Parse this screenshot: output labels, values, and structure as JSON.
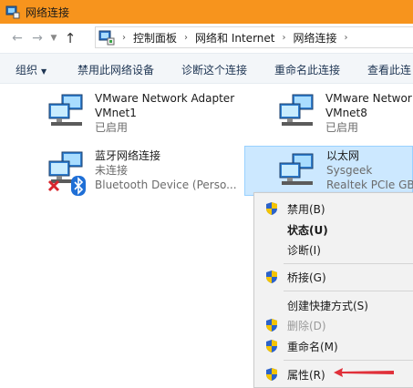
{
  "window": {
    "title": "网络连接"
  },
  "address": {
    "crumbs": [
      "控制面板",
      "网络和 Internet",
      "网络连接"
    ]
  },
  "toolbar": {
    "organize": "组织",
    "disable": "禁用此网络设备",
    "diagnose": "诊断这个连接",
    "rename": "重命名此连接",
    "view_status": "查看此连"
  },
  "items": [
    {
      "name": "VMware Network Adapter",
      "sub": "VMnet1",
      "status": "已启用"
    },
    {
      "name": "VMware Networ",
      "sub": "VMnet8",
      "status": "已启用"
    },
    {
      "name": "蓝牙网络连接",
      "sub": "未连接",
      "status": "Bluetooth Device (Perso..."
    },
    {
      "name": "以太网",
      "sub": "Sysgeek",
      "status": "Realtek PCIe GB"
    }
  ],
  "menu": {
    "disable": "禁用(B)",
    "status": "状态(U)",
    "diagnose": "诊断(I)",
    "bridge": "桥接(G)",
    "shortcut": "创建快捷方式(S)",
    "delete": "删除(D)",
    "rename": "重命名(M)",
    "properties": "属性(R)"
  },
  "colors": {
    "titlebar": "#f7941d",
    "selection": "#cce8ff",
    "arrow": "#e0303a"
  }
}
